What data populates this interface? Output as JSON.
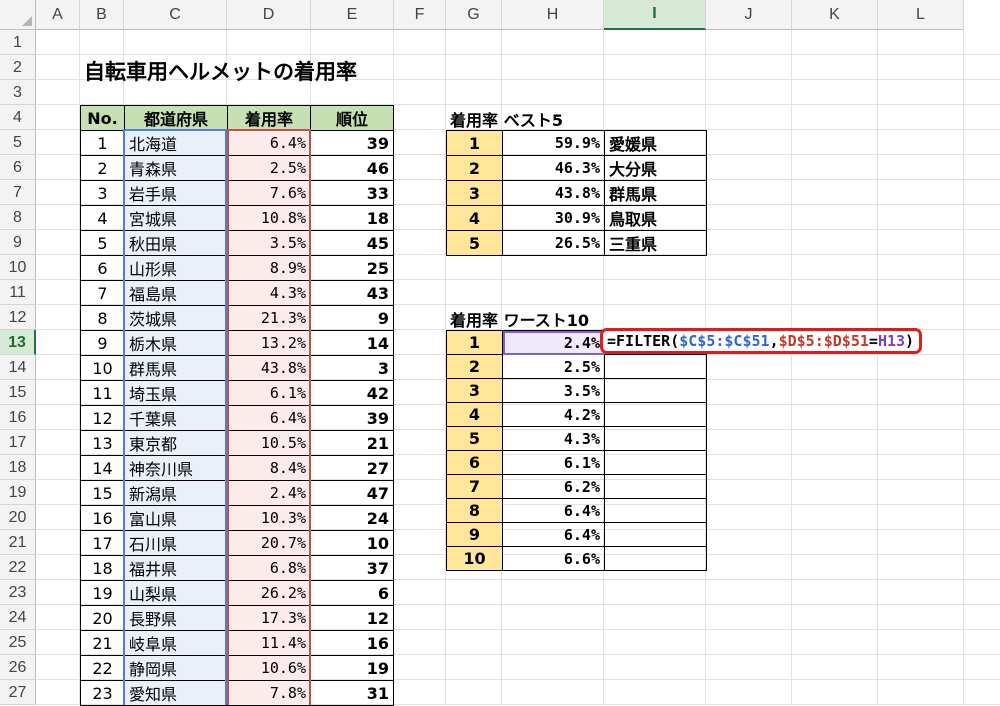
{
  "columns": [
    "A",
    "B",
    "C",
    "D",
    "E",
    "F",
    "G",
    "H",
    "I",
    "J",
    "K",
    "L"
  ],
  "rows": [
    "1",
    "2",
    "3",
    "4",
    "5",
    "6",
    "7",
    "8",
    "9",
    "10",
    "11",
    "12",
    "13",
    "14",
    "15",
    "16",
    "17",
    "18",
    "19",
    "20",
    "21",
    "22",
    "23",
    "24",
    "25",
    "26",
    "27"
  ],
  "title": "自転車用ヘルメットの着用率",
  "main_table": {
    "headers": {
      "no": "No.",
      "pref": "都道府県",
      "rate": "着用率",
      "rank": "順位"
    },
    "rows": [
      {
        "no": "1",
        "pref": "北海道",
        "rate": "6.4%",
        "rank": "39"
      },
      {
        "no": "2",
        "pref": "青森県",
        "rate": "2.5%",
        "rank": "46"
      },
      {
        "no": "3",
        "pref": "岩手県",
        "rate": "7.6%",
        "rank": "33"
      },
      {
        "no": "4",
        "pref": "宮城県",
        "rate": "10.8%",
        "rank": "18"
      },
      {
        "no": "5",
        "pref": "秋田県",
        "rate": "3.5%",
        "rank": "45"
      },
      {
        "no": "6",
        "pref": "山形県",
        "rate": "8.9%",
        "rank": "25"
      },
      {
        "no": "7",
        "pref": "福島県",
        "rate": "4.3%",
        "rank": "43"
      },
      {
        "no": "8",
        "pref": "茨城県",
        "rate": "21.3%",
        "rank": "9"
      },
      {
        "no": "9",
        "pref": "栃木県",
        "rate": "13.2%",
        "rank": "14"
      },
      {
        "no": "10",
        "pref": "群馬県",
        "rate": "43.8%",
        "rank": "3"
      },
      {
        "no": "11",
        "pref": "埼玉県",
        "rate": "6.1%",
        "rank": "42"
      },
      {
        "no": "12",
        "pref": "千葉県",
        "rate": "6.4%",
        "rank": "39"
      },
      {
        "no": "13",
        "pref": "東京都",
        "rate": "10.5%",
        "rank": "21"
      },
      {
        "no": "14",
        "pref": "神奈川県",
        "rate": "8.4%",
        "rank": "27"
      },
      {
        "no": "15",
        "pref": "新潟県",
        "rate": "2.4%",
        "rank": "47"
      },
      {
        "no": "16",
        "pref": "富山県",
        "rate": "10.3%",
        "rank": "24"
      },
      {
        "no": "17",
        "pref": "石川県",
        "rate": "20.7%",
        "rank": "10"
      },
      {
        "no": "18",
        "pref": "福井県",
        "rate": "6.8%",
        "rank": "37"
      },
      {
        "no": "19",
        "pref": "山梨県",
        "rate": "26.2%",
        "rank": "6"
      },
      {
        "no": "20",
        "pref": "長野県",
        "rate": "17.3%",
        "rank": "12"
      },
      {
        "no": "21",
        "pref": "岐阜県",
        "rate": "11.4%",
        "rank": "16"
      },
      {
        "no": "22",
        "pref": "静岡県",
        "rate": "10.6%",
        "rank": "19"
      },
      {
        "no": "23",
        "pref": "愛知県",
        "rate": "7.8%",
        "rank": "31"
      }
    ]
  },
  "best5": {
    "label": "着用率 ベスト5",
    "rows": [
      {
        "rank": "1",
        "rate": "59.9%",
        "pref": "愛媛県"
      },
      {
        "rank": "2",
        "rate": "46.3%",
        "pref": "大分県"
      },
      {
        "rank": "3",
        "rate": "43.8%",
        "pref": "群馬県"
      },
      {
        "rank": "4",
        "rate": "30.9%",
        "pref": "鳥取県"
      },
      {
        "rank": "5",
        "rate": "26.5%",
        "pref": "三重県"
      }
    ]
  },
  "worst10": {
    "label": "着用率 ワースト10",
    "rows": [
      {
        "rank": "1",
        "rate": "2.4%"
      },
      {
        "rank": "2",
        "rate": "2.5%"
      },
      {
        "rank": "3",
        "rate": "3.5%"
      },
      {
        "rank": "4",
        "rate": "4.2%"
      },
      {
        "rank": "5",
        "rate": "4.3%"
      },
      {
        "rank": "6",
        "rate": "6.1%"
      },
      {
        "rank": "7",
        "rate": "6.2%"
      },
      {
        "rank": "8",
        "rate": "6.4%"
      },
      {
        "rank": "9",
        "rate": "6.4%"
      },
      {
        "rank": "10",
        "rate": "6.6%"
      }
    ]
  },
  "formula": {
    "prefix": "=FILTER(",
    "range_c": "$C$5:$C$51",
    "comma": ",",
    "range_d": "$D$5:$D$51",
    "eq": "=",
    "ref_h": "H13",
    "suffix": ")"
  },
  "selection": {
    "column": "I",
    "row": "13"
  }
}
